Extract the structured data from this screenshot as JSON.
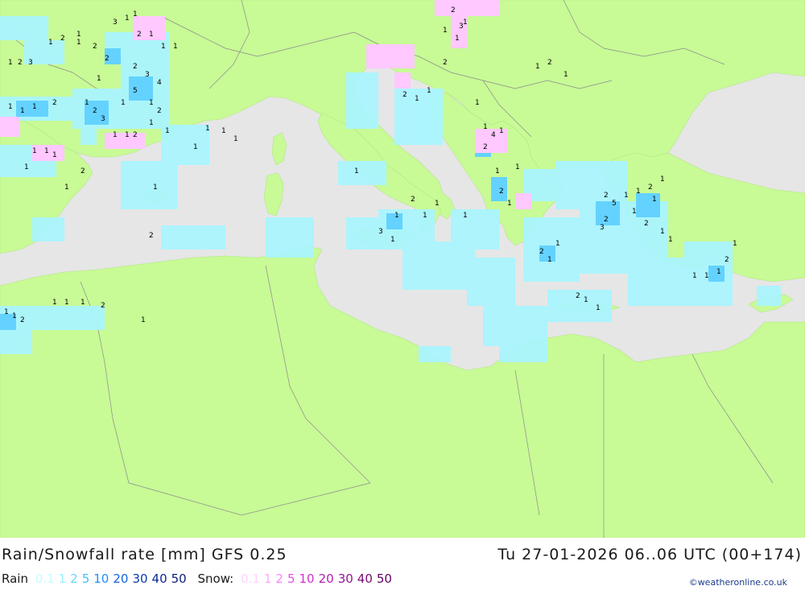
{
  "title": "Rain/Snowfall rate [mm] GFS 0.25",
  "datetime": "Tu 27-01-2026 06..06 UTC (00+174)",
  "legend": {
    "rain_label": "Rain",
    "rain_values": [
      {
        "text": "0.1",
        "color": "#c8faff"
      },
      {
        "text": "1",
        "color": "#96f0ff"
      },
      {
        "text": "2",
        "color": "#64d8ff"
      },
      {
        "text": "5",
        "color": "#3cc0ff"
      },
      {
        "text": "10",
        "color": "#1e90ff"
      },
      {
        "text": "20",
        "color": "#1464dc"
      },
      {
        "text": "30",
        "color": "#0a3cb4"
      },
      {
        "text": "40",
        "color": "#0a2896"
      },
      {
        "text": "50",
        "color": "#0a1e78"
      }
    ],
    "snow_label": "Snow:",
    "snow_values": [
      {
        "text": "0.1",
        "color": "#ffd2ff"
      },
      {
        "text": "1",
        "color": "#ffaaff"
      },
      {
        "text": "2",
        "color": "#ff82ff"
      },
      {
        "text": "5",
        "color": "#e650e6"
      },
      {
        "text": "10",
        "color": "#d232d2"
      },
      {
        "text": "20",
        "color": "#b41eb4"
      },
      {
        "text": "30",
        "color": "#961496"
      },
      {
        "text": "40",
        "color": "#780a78"
      },
      {
        "text": "50",
        "color": "#640064"
      }
    ]
  },
  "credit": "©weatheronline.co.uk",
  "colors": {
    "land": "#c8fa96",
    "sea": "#e6e6e6",
    "border": "#8c8c8c",
    "rain_light": "#aaf5ff",
    "rain_medium": "#64d2ff",
    "snow_light": "#ffc8ff"
  },
  "precip_labels": [
    "1",
    "2",
    "3",
    "1",
    "2",
    "1",
    "2",
    "3",
    "1",
    "1",
    "2",
    "1",
    "1",
    "2",
    "3",
    "4",
    "5",
    "1",
    "2",
    "1",
    "1",
    "2",
    "3",
    "1",
    "1",
    "2",
    "1",
    "1",
    "1",
    "2",
    "1",
    "1",
    "1",
    "1",
    "1",
    "2",
    "1",
    "1",
    "1",
    "1",
    "2",
    "3",
    "1",
    "1",
    "2",
    "1",
    "4",
    "2",
    "1",
    "1",
    "2",
    "1",
    "1",
    "2",
    "1",
    "1",
    "1",
    "1",
    "2",
    "1",
    "3",
    "2",
    "1",
    "1",
    "2",
    "1",
    "1",
    "2",
    "5",
    "1",
    "1",
    "2",
    "1",
    "1",
    "1",
    "2",
    "1",
    "1",
    "2",
    "3",
    "1",
    "1",
    "1",
    "2",
    "1",
    "1",
    "1",
    "1",
    "2",
    "1",
    "1",
    "2",
    "1",
    "1",
    "2",
    "1",
    "1",
    "1",
    "1",
    "1",
    "2",
    "1",
    "1",
    "1",
    "2",
    "1",
    "1",
    "1",
    "1"
  ]
}
